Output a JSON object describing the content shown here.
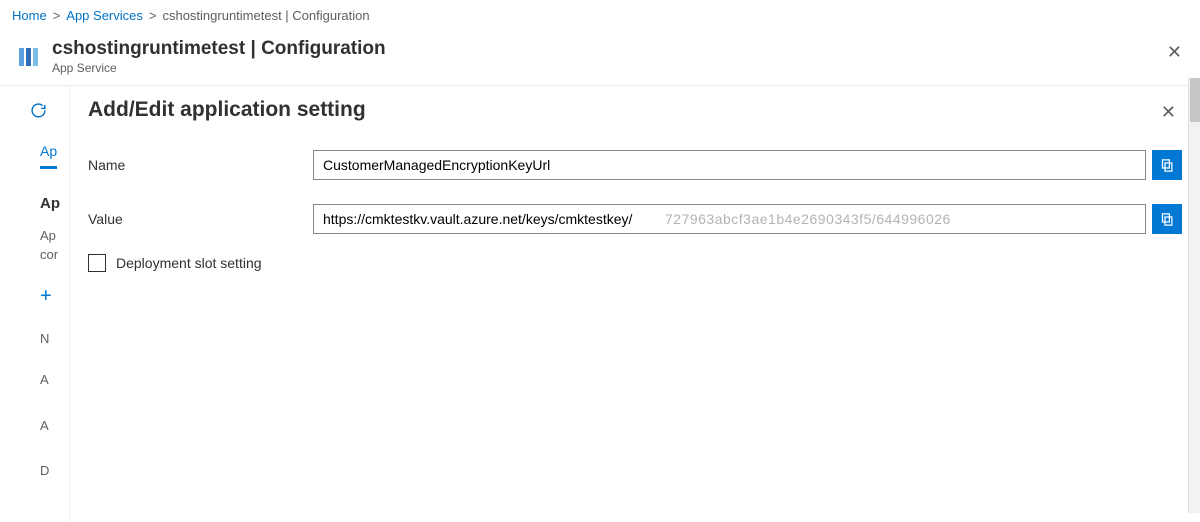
{
  "breadcrumb": {
    "home": "Home",
    "app_services": "App Services",
    "current": "cshostingruntimetest | Configuration"
  },
  "header": {
    "title": "cshostingruntimetest | Configuration",
    "subtitle": "App Service"
  },
  "sidebar_under": {
    "tab_label": "Ap",
    "section_label": "Ap",
    "sub1": "Ap",
    "sub2": "cor",
    "add": "+",
    "colh": "N",
    "rowa": "A",
    "rowb": "A",
    "rowc": "D"
  },
  "panel": {
    "title": "Add/Edit application setting",
    "fields": {
      "name_label": "Name",
      "name_value": "CustomerManagedEncryptionKeyUrl",
      "value_label": "Value",
      "value_value": "https://cmktestkv.vault.azure.net/keys/cmktestkey/",
      "value_obscured_tail": "727963abcf3ae1b4e2690343f5/644996026",
      "deployment_slot_label": "Deployment slot setting"
    }
  }
}
